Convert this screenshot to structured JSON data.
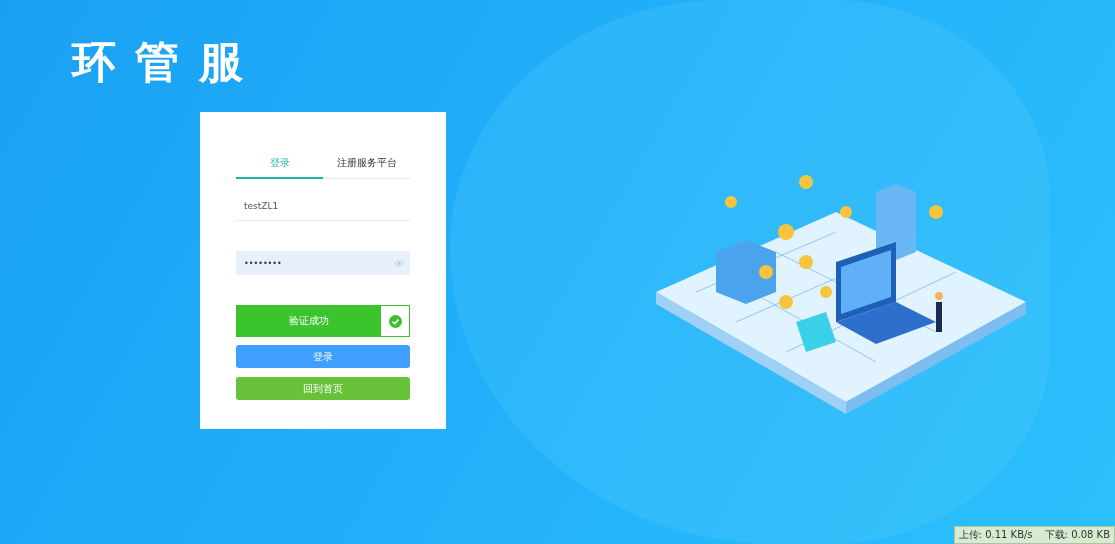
{
  "logo": {
    "title": "环 管 服"
  },
  "tabs": [
    {
      "label": "登录",
      "selected": true
    },
    {
      "label": "注册服务平台",
      "selected": false
    }
  ],
  "username": {
    "value": "testZL1"
  },
  "password": {
    "value": "••••••••"
  },
  "verify": {
    "label": "验证成功",
    "verified": true
  },
  "buttons": [
    {
      "label": "登录",
      "kind": "primary"
    },
    {
      "label": "回到首页",
      "kind": "home"
    }
  ],
  "status_bar": {
    "upload": "上传: 0.11 KB/s",
    "download": "下载: 0.08 KB"
  }
}
